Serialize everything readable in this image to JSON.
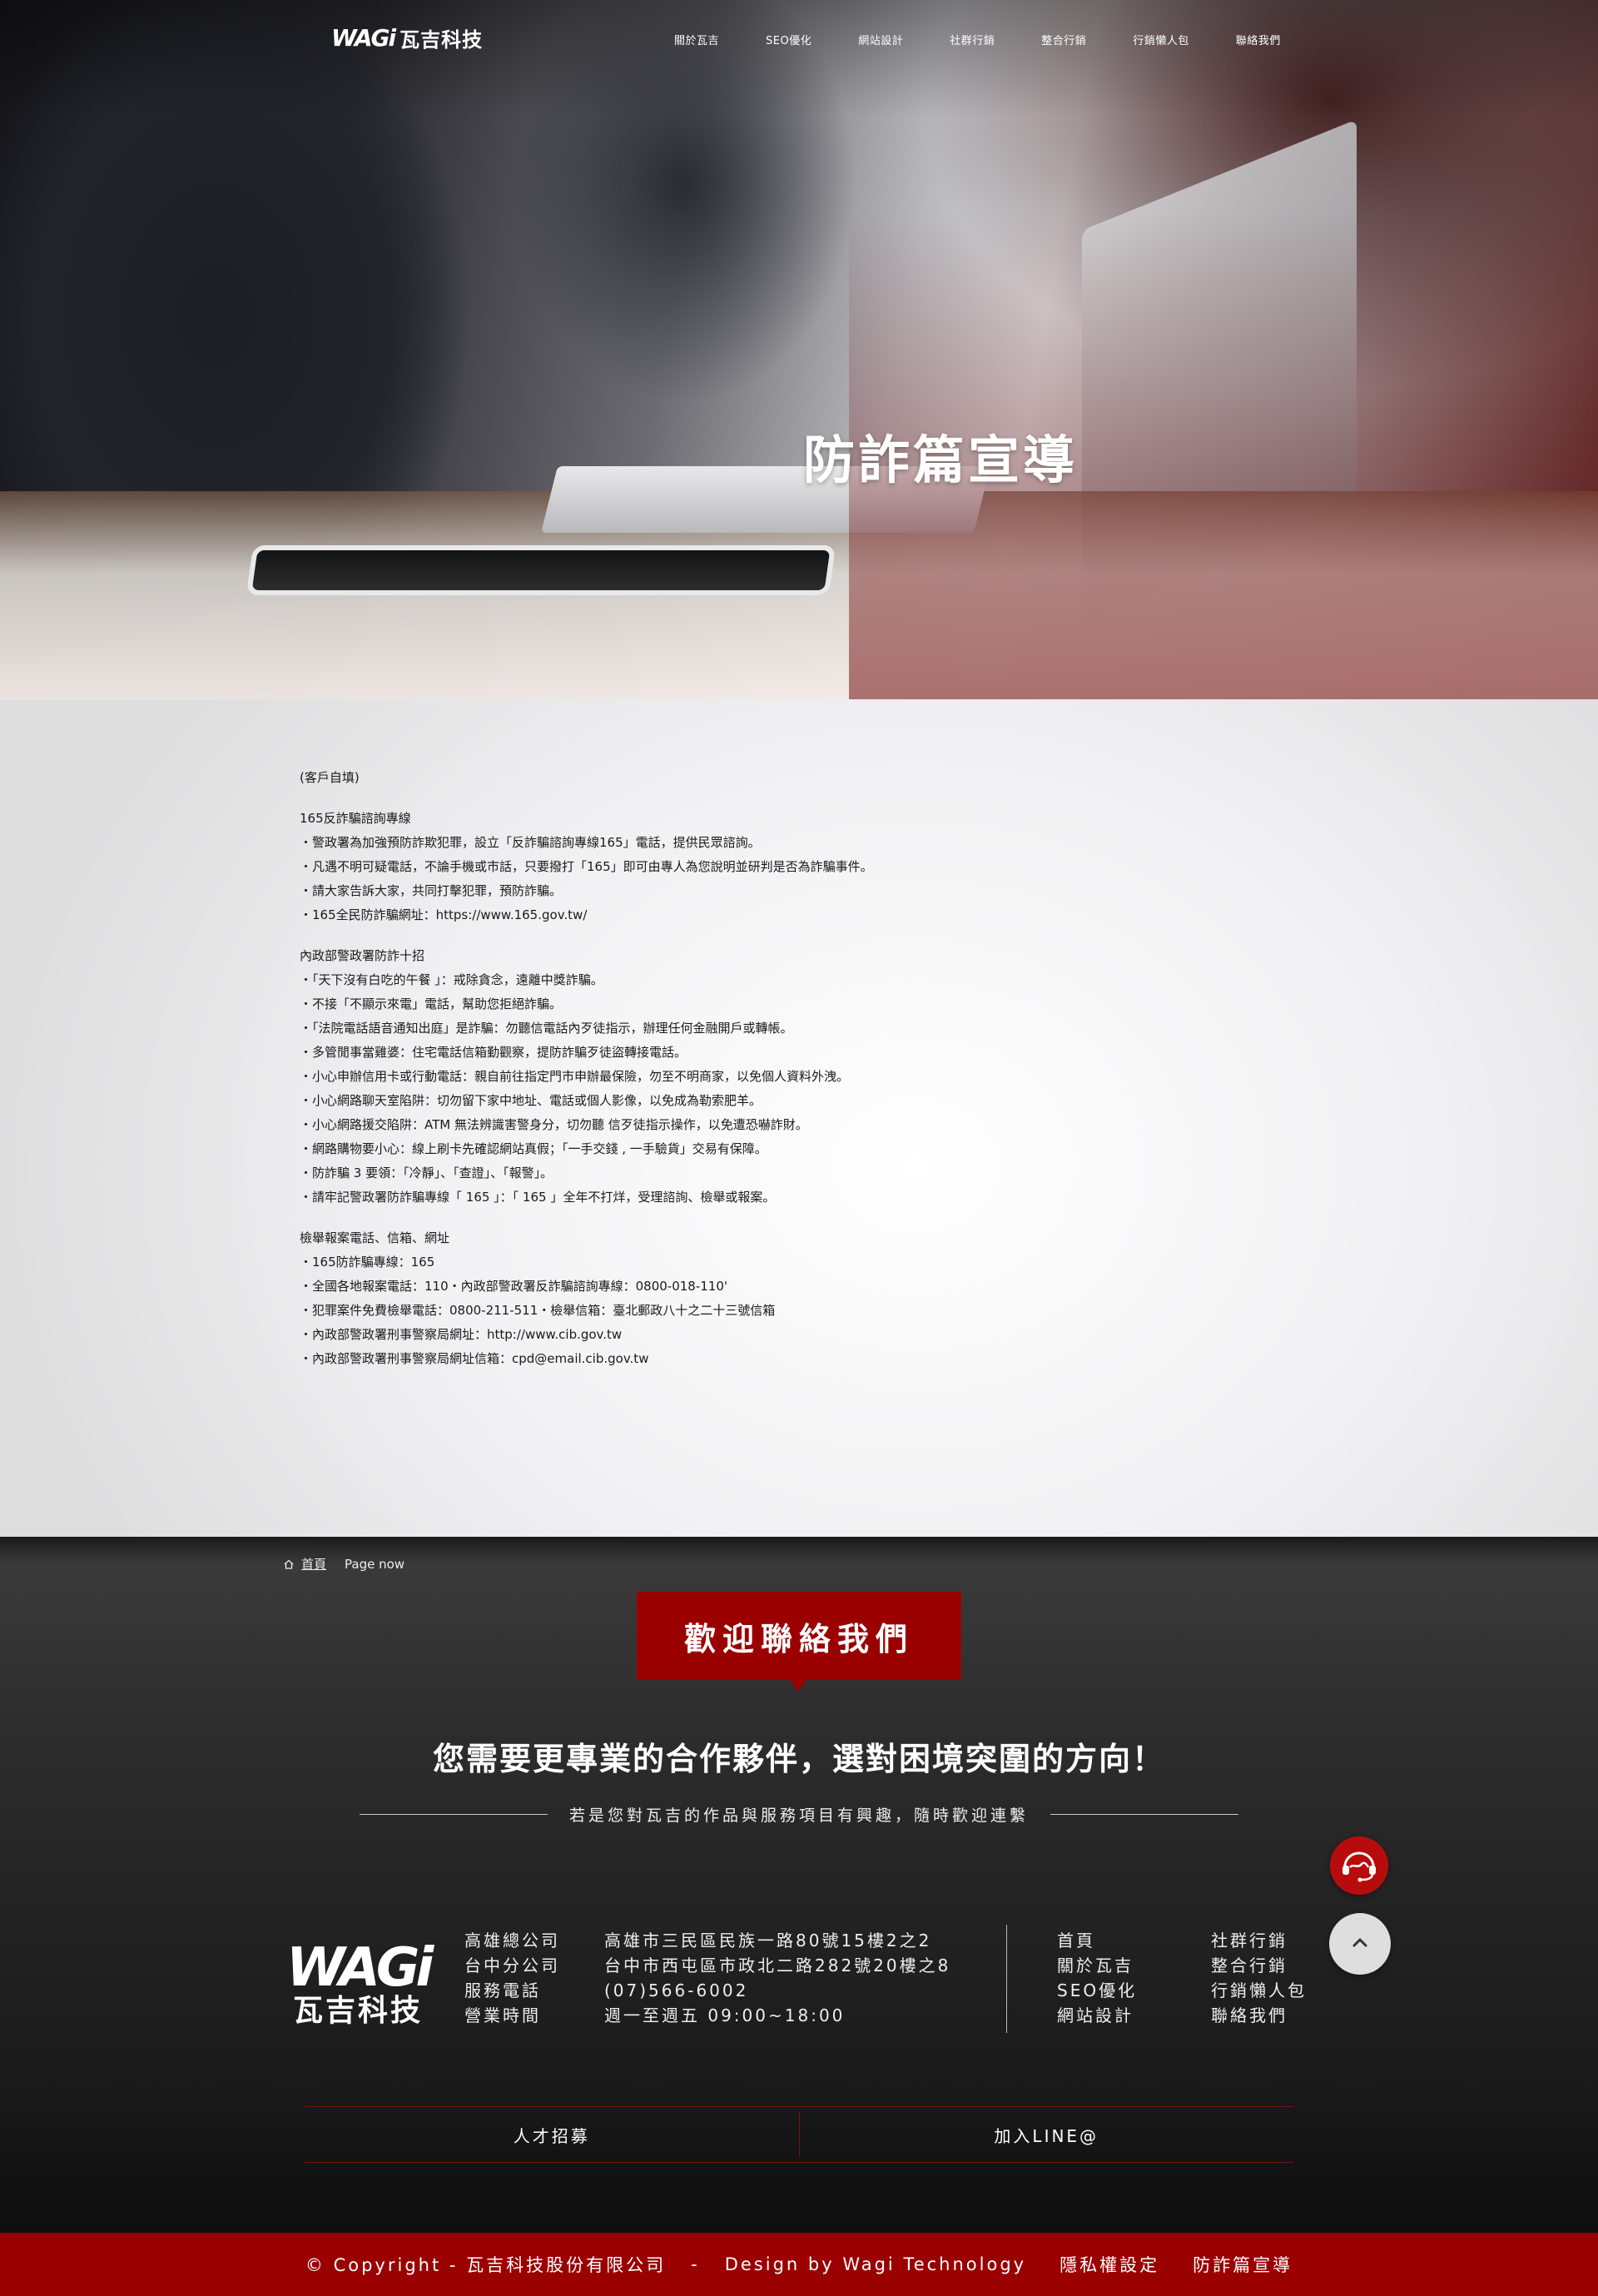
{
  "header": {
    "logo_mark": "WAGi",
    "logo_text": "瓦吉科技",
    "nav": [
      "關於瓦吉",
      "SEO優化",
      "網站設計",
      "社群行銷",
      "整合行銷",
      "行銷懶人包",
      "聯絡我們"
    ]
  },
  "hero": {
    "title": "防詐篇宣導"
  },
  "article": {
    "intro": "(客戶自填)",
    "sections": [
      {
        "heading": "165反詐騙諮詢專線",
        "lines": [
          "・警政署為加強預防詐欺犯罪，設立「反詐騙諮詢專線165」電話，提供民眾諮詢。",
          "・凡遇不明可疑電話，不論手機或市話，只要撥打「165」即可由專人為您說明並研判是否為詐騙事件。",
          "・請大家告訴大家，共同打擊犯罪，預防詐騙。",
          "・165全民防詐騙網址：https://www.165.gov.tw/"
        ]
      },
      {
        "heading": "內政部警政署防詐十招",
        "lines": [
          "・「天下沒有白吃的午餐 」：戒除貪念，遠離中獎詐騙。",
          "・不接「不顯示來電」電話，幫助您拒絕詐騙。",
          "・「法院電話語音通知出庭」是詐騙：勿聽信電話內歹徒指示，辦理任何金融開戶或轉帳。",
          "・多管閒事當雞婆：住宅電話信箱勤觀察，提防詐騙歹徒盜轉接電話。",
          "・小心申辦信用卡或行動電話：親自前往指定門市申辦最保險，勿至不明商家，以免個人資料外洩。",
          "・小心網路聊天室陷阱：切勿留下家中地址、電話或個人影像，以免成為勒索肥羊。",
          "・小心網路援交陷阱：ATM 無法辨識害警身分，切勿聽 信歹徒指示操作，以免遭恐嚇詐財。",
          "・網路購物要小心：線上刷卡先確認網站真假；「一手交錢 , 一手驗貨」交易有保障。",
          "・防詐騙 3 要領：「冷靜」、「查證」、「報警」。",
          "・請牢記警政署防詐騙專線「 165 」：「 165 」全年不打烊，受理諮詢、檢舉或報案。"
        ]
      },
      {
        "heading": "檢舉報案電話、信箱、網址",
        "lines": [
          "・165防詐騙專線：165",
          "・全國各地報案電話：110・內政部警政署反詐騙諮詢專線：0800-018-110'",
          "・犯罪案件免費檢舉電話：0800-211-511・檢舉信箱：臺北郵政八十之二十三號信箱",
          "・內政部警政署刑事警察局網址：http://www.cib.gov.tw",
          "・內政部警政署刑事警察局網址信箱：cpd@email.cib.gov.tw"
        ]
      }
    ]
  },
  "breadcrumb": {
    "home": "首頁",
    "current": "Page now"
  },
  "contact": {
    "badge": "歡迎聯絡我們",
    "slogan": "您需要更專業的合作夥伴，選對困境突圍的方向！",
    "subline": "若是您對瓦吉的作品與服務項目有興趣，隨時歡迎連繫"
  },
  "footer": {
    "logo_mark": "WAGi",
    "logo_text": "瓦吉科技",
    "info": [
      {
        "label": "高雄總公司",
        "value": "高雄市三民區民族一路80號15樓2之2"
      },
      {
        "label": "台中分公司",
        "value": "台中市西屯區市政北二路282號20樓之8"
      },
      {
        "label": "服務電話",
        "value": "(07)566-6002"
      },
      {
        "label": "營業時間",
        "value": "週一至週五 09:00~18:00"
      }
    ],
    "nav": [
      "首頁",
      "社群行銷",
      "關於瓦吉",
      "整合行銷",
      "SEO優化",
      "行銷懶人包",
      "網站設計",
      "聯絡我們"
    ],
    "bottom_links": [
      "人才招募",
      "加入LINE@"
    ],
    "copyright": "© Copyright - 瓦吉科技股份有限公司",
    "separator": "-",
    "design": "Design by Wagi Technology",
    "privacy": "隱私權設定",
    "fraud": "防詐篇宣導"
  },
  "icons": {
    "chat": "customer-service-icon",
    "top": "chevron-up-icon",
    "home": "home-icon"
  },
  "colors": {
    "brand_red": "#9a0000",
    "chat_red": "#b80c0c"
  }
}
